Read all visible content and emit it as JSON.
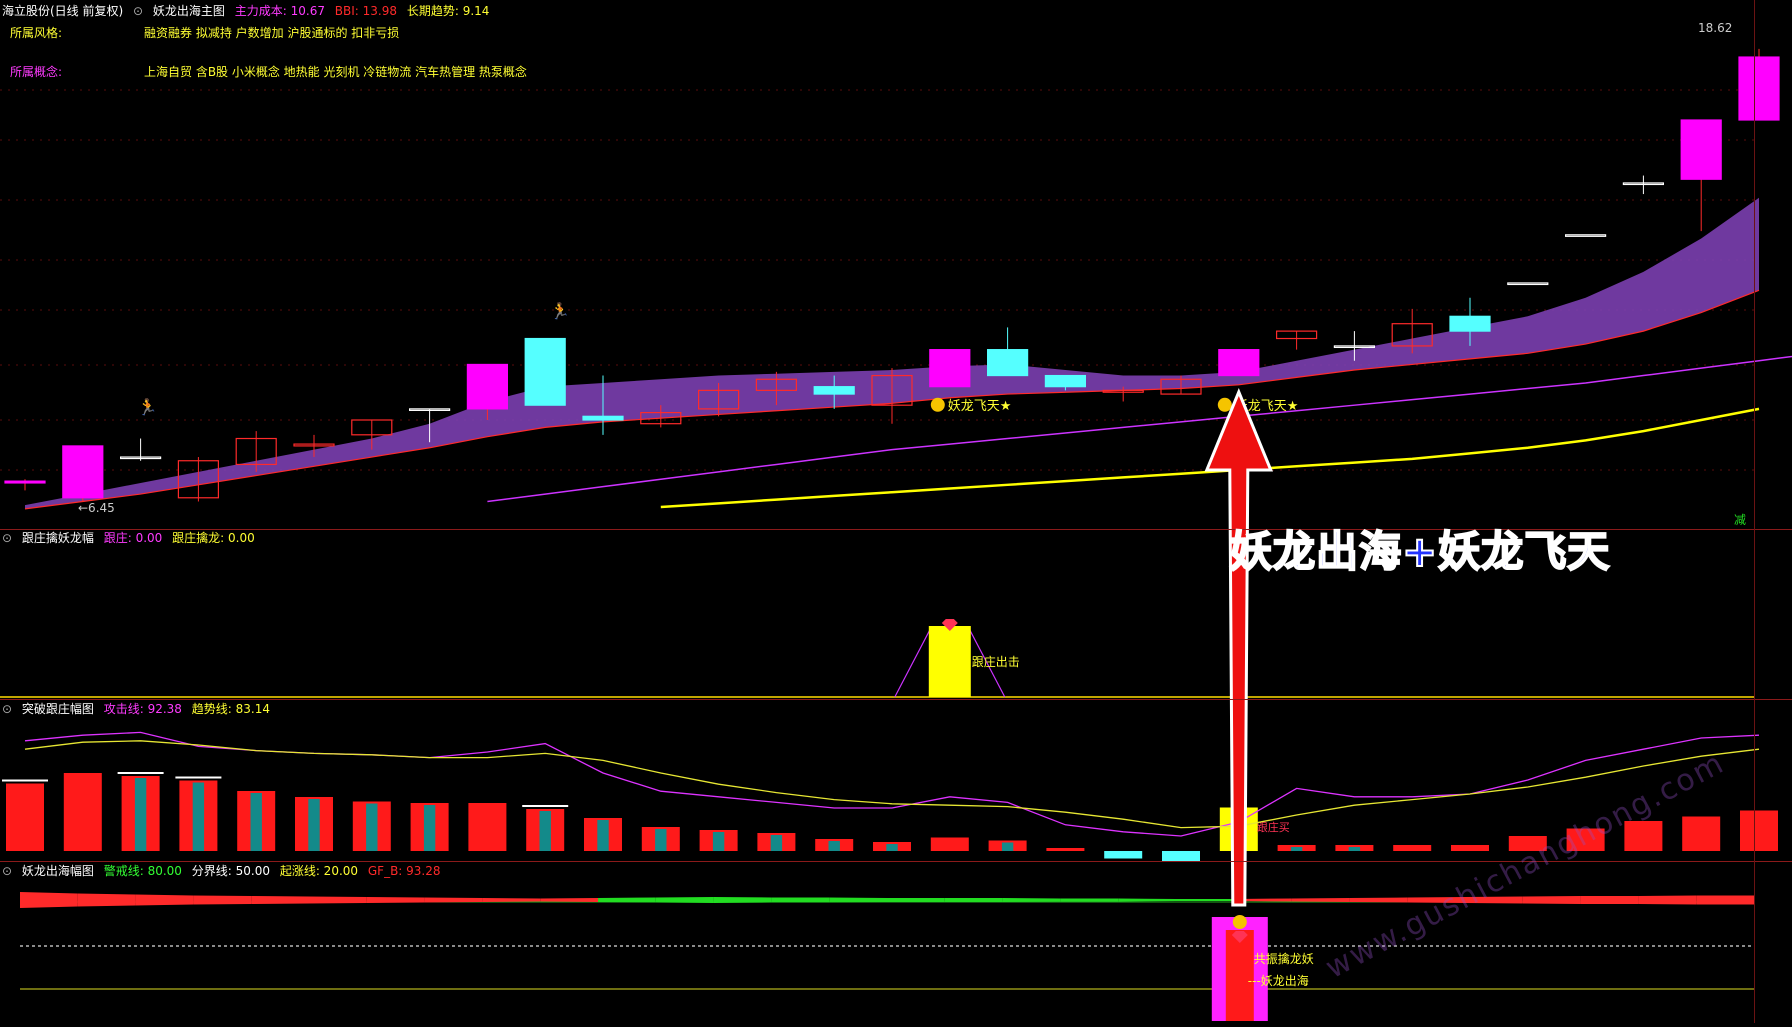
{
  "main_header": {
    "stock": "海立股份(日线 前复权)",
    "indicator": "妖龙出海主图",
    "items": [
      {
        "label": "主力成本: 10.67",
        "color": "#ff3bff"
      },
      {
        "label": "BBI: 13.98",
        "color": "#ff2a2a"
      },
      {
        "label": "长期趋势: 9.14",
        "color": "#ffff33"
      }
    ]
  },
  "info": {
    "style_label": "所属风格:",
    "style_value": "融资融券 拟减持 户数增加 沪股通标的 扣非亏损",
    "concept_label": "所属概念:",
    "concept_value": "上海自贸 含B股 小米概念 地热能 光刻机 冷链物流 汽车热管理 热泵概念"
  },
  "panel2_header": {
    "indicator": "跟庄擒妖龙幅",
    "items": [
      {
        "label": "跟庄: 0.00",
        "color": "#ff3bff"
      },
      {
        "label": "跟庄擒龙: 0.00",
        "color": "#ffff33"
      }
    ]
  },
  "panel3_header": {
    "indicator": "突破跟庄幅图",
    "items": [
      {
        "label": "攻击线: 92.38",
        "color": "#ff3bff"
      },
      {
        "label": "趋势线: 83.14",
        "color": "#ffff33"
      }
    ]
  },
  "panel4_header": {
    "indicator": "妖龙出海幅图",
    "items": [
      {
        "label": "警戒线: 80.00",
        "color": "#33ff33"
      },
      {
        "label": "分界线: 50.00",
        "color": "#ffffff"
      },
      {
        "label": "起涨线: 20.00",
        "color": "#ffff33"
      },
      {
        "label": "GF_B: 93.28",
        "color": "#ff2a2a"
      }
    ]
  },
  "overlay_title": "妖龙出海+妖龙飞天",
  "watermark": "www.gushichanghong.com",
  "colors": {
    "up": "#ff2a2a",
    "down": "#55ffff",
    "magenta": "#ff00ff",
    "yellow": "#ffff00",
    "band": "#7b3fb0",
    "green": "#22dd22"
  },
  "chart_data": [
    {
      "type": "candlestick",
      "name": "main",
      "price_labels": {
        "high": "18.62",
        "low": "6.45"
      },
      "ylim": [
        5.9,
        19.4
      ],
      "annotations": [
        "妖龙飞天★",
        "妖龙飞天★",
        "减"
      ],
      "candles": [
        {
          "o": 6.9,
          "h": 7.0,
          "l": 6.7,
          "c": 6.95,
          "fill": "magenta"
        },
        {
          "o": 6.5,
          "h": 7.9,
          "l": 6.4,
          "c": 7.9,
          "fill": "magenta"
        },
        {
          "o": 7.6,
          "h": 8.1,
          "l": 7.5,
          "c": 7.6,
          "fill": "hollow"
        },
        {
          "o": 6.5,
          "h": 7.6,
          "l": 6.4,
          "c": 7.5,
          "fill": "hollow"
        },
        {
          "o": 7.4,
          "h": 8.3,
          "l": 7.2,
          "c": 8.1,
          "fill": "hollow"
        },
        {
          "o": 7.9,
          "h": 8.2,
          "l": 7.6,
          "c": 7.95,
          "fill": "hollow"
        },
        {
          "o": 8.2,
          "h": 8.6,
          "l": 7.8,
          "c": 8.6,
          "fill": "hollow"
        },
        {
          "o": 8.9,
          "h": 8.9,
          "l": 8.0,
          "c": 8.9,
          "fill": "hollow"
        },
        {
          "o": 8.9,
          "h": 10.1,
          "l": 8.6,
          "c": 10.1,
          "fill": "magenta"
        },
        {
          "o": 10.8,
          "h": 10.8,
          "l": 9.0,
          "c": 9.0,
          "fill": "cyan"
        },
        {
          "o": 8.7,
          "h": 9.8,
          "l": 8.2,
          "c": 8.6,
          "fill": "cyan"
        },
        {
          "o": 8.5,
          "h": 9.0,
          "l": 8.4,
          "c": 8.8,
          "fill": "hollow"
        },
        {
          "o": 8.9,
          "h": 9.6,
          "l": 8.7,
          "c": 9.4,
          "fill": "hollow"
        },
        {
          "o": 9.4,
          "h": 9.9,
          "l": 9.0,
          "c": 9.7,
          "fill": "hollow"
        },
        {
          "o": 9.5,
          "h": 9.8,
          "l": 8.9,
          "c": 9.3,
          "fill": "cyan"
        },
        {
          "o": 9.0,
          "h": 10.0,
          "l": 8.5,
          "c": 9.8,
          "fill": "hollow"
        },
        {
          "o": 9.5,
          "h": 10.5,
          "l": 9.5,
          "c": 10.5,
          "fill": "magenta"
        },
        {
          "o": 10.5,
          "h": 11.1,
          "l": 9.8,
          "c": 9.8,
          "fill": "cyan"
        },
        {
          "o": 9.8,
          "h": 9.8,
          "l": 9.4,
          "c": 9.5,
          "fill": "cyan"
        },
        {
          "o": 9.35,
          "h": 9.5,
          "l": 9.1,
          "c": 9.4,
          "fill": "hollow"
        },
        {
          "o": 9.3,
          "h": 9.8,
          "l": 9.3,
          "c": 9.7,
          "fill": "hollow"
        },
        {
          "o": 9.8,
          "h": 10.5,
          "l": 9.8,
          "c": 10.5,
          "fill": "magenta"
        },
        {
          "o": 10.8,
          "h": 11.0,
          "l": 10.5,
          "c": 11.0,
          "fill": "hollow"
        },
        {
          "o": 10.6,
          "h": 11.0,
          "l": 10.2,
          "c": 10.6,
          "fill": "hollow"
        },
        {
          "o": 10.6,
          "h": 11.6,
          "l": 10.4,
          "c": 11.2,
          "fill": "hollow"
        },
        {
          "o": 11.4,
          "h": 11.9,
          "l": 10.6,
          "c": 11.0,
          "fill": "cyan"
        },
        {
          "o": 12.3,
          "h": 12.3,
          "l": 12.3,
          "c": 12.3,
          "fill": "hollow"
        },
        {
          "o": 13.6,
          "h": 13.6,
          "l": 13.6,
          "c": 13.6,
          "fill": "hollow"
        },
        {
          "o": 15.0,
          "h": 15.2,
          "l": 14.7,
          "c": 15.0,
          "fill": "hollow"
        },
        {
          "o": 15.1,
          "h": 16.7,
          "l": 13.7,
          "c": 16.7,
          "fill": "magenta"
        },
        {
          "o": 16.7,
          "h": 18.62,
          "l": 16.7,
          "c": 18.4,
          "fill": "magenta"
        }
      ],
      "band_upper": [
        6.3,
        6.6,
        6.9,
        7.2,
        7.5,
        7.8,
        8.1,
        8.5,
        9.1,
        9.5,
        9.6,
        9.7,
        9.8,
        9.85,
        9.9,
        9.95,
        10.05,
        10.1,
        9.95,
        9.8,
        9.8,
        9.9,
        10.2,
        10.5,
        10.8,
        11.1,
        11.4,
        11.9,
        12.6,
        13.5,
        14.6
      ],
      "band_lower": [
        6.2,
        6.4,
        6.6,
        6.85,
        7.1,
        7.35,
        7.6,
        7.85,
        8.15,
        8.4,
        8.55,
        8.65,
        8.75,
        8.85,
        8.95,
        9.05,
        9.2,
        9.3,
        9.35,
        9.4,
        9.45,
        9.55,
        9.75,
        9.95,
        10.1,
        10.25,
        10.4,
        10.65,
        11.0,
        11.5,
        12.1
      ],
      "magenta_line_start_index": 8,
      "magenta_line": [
        6.4,
        6.6,
        6.8,
        7.0,
        7.2,
        7.4,
        7.6,
        7.8,
        7.95,
        8.1,
        8.25,
        8.4,
        8.55,
        8.7,
        8.85,
        9.0,
        9.15,
        9.3,
        9.45,
        9.6,
        9.8,
        10.0,
        10.2,
        10.4
      ],
      "yellow_line_start_index": 11,
      "yellow_line": [
        6.25,
        6.35,
        6.45,
        6.55,
        6.65,
        6.75,
        6.85,
        6.95,
        7.05,
        7.15,
        7.25,
        7.35,
        7.45,
        7.55,
        7.7,
        7.85,
        8.05,
        8.3,
        8.6,
        8.9
      ]
    },
    {
      "type": "bar",
      "name": "跟庄擒妖龙幅",
      "label": "跟庄出击",
      "bar_index": 16,
      "value": 1
    },
    {
      "type": "bar",
      "name": "突破跟庄幅图",
      "ylim": [
        0,
        100
      ],
      "label": "跟庄买",
      "bars": [
        {
          "v": 45,
          "s": "red",
          "cap": true
        },
        {
          "v": 52,
          "s": "red",
          "cap": false
        },
        {
          "v": 50,
          "s": "split",
          "cap": true
        },
        {
          "v": 47,
          "s": "split",
          "cap": true
        },
        {
          "v": 40,
          "s": "split",
          "cap": false
        },
        {
          "v": 36,
          "s": "split",
          "cap": false
        },
        {
          "v": 33,
          "s": "split",
          "cap": false
        },
        {
          "v": 32,
          "s": "split",
          "cap": false
        },
        {
          "v": 32,
          "s": "red",
          "cap": false
        },
        {
          "v": 28,
          "s": "split",
          "cap": true
        },
        {
          "v": 22,
          "s": "split",
          "cap": false
        },
        {
          "v": 16,
          "s": "split",
          "cap": false
        },
        {
          "v": 14,
          "s": "split",
          "cap": false
        },
        {
          "v": 12,
          "s": "split",
          "cap": false
        },
        {
          "v": 8,
          "s": "split",
          "cap": false
        },
        {
          "v": 6,
          "s": "split",
          "cap": false
        },
        {
          "v": 9,
          "s": "red",
          "cap": false
        },
        {
          "v": 7,
          "s": "split",
          "cap": false
        },
        {
          "v": 2,
          "s": "red",
          "cap": false
        },
        {
          "v": -5,
          "s": "cyan",
          "cap": false
        },
        {
          "v": -7,
          "s": "cyan",
          "cap": false
        },
        {
          "v": 29,
          "s": "yellow",
          "cap": false
        },
        {
          "v": 4,
          "s": "split",
          "cap": false
        },
        {
          "v": 4,
          "s": "split",
          "cap": false
        },
        {
          "v": 4,
          "s": "red",
          "cap": false
        },
        {
          "v": 4,
          "s": "red",
          "cap": false
        },
        {
          "v": 10,
          "s": "red",
          "cap": false
        },
        {
          "v": 15,
          "s": "red",
          "cap": false
        },
        {
          "v": 20,
          "s": "red",
          "cap": false
        },
        {
          "v": 23,
          "s": "red",
          "cap": false
        },
        {
          "v": 27,
          "s": "red",
          "cap": false
        }
      ],
      "attack_line": [
        78,
        82,
        84,
        74,
        71,
        69,
        68,
        66,
        70,
        76,
        55,
        42,
        38,
        34,
        30,
        30,
        38,
        34,
        18,
        13,
        10,
        20,
        44,
        38,
        38,
        40,
        50,
        64,
        72,
        80,
        82
      ],
      "trend_line": [
        72,
        77,
        78,
        75,
        71,
        69,
        68,
        66,
        66,
        69,
        64,
        55,
        47,
        41,
        36,
        33,
        32,
        31,
        27,
        22,
        16,
        17,
        25,
        32,
        36,
        40,
        45,
        52,
        60,
        67,
        72
      ]
    },
    {
      "type": "area",
      "name": "妖龙出海幅图",
      "ylim": [
        0,
        100
      ],
      "lines": [
        80,
        50,
        20
      ],
      "labels": [
        "共振擒龙妖",
        "---妖龙出海"
      ],
      "signal_index": 21,
      "ribbon_sign": [
        1,
        1,
        1,
        1,
        1,
        1,
        1,
        1,
        1,
        1,
        -1,
        -1,
        -1,
        -1,
        -1,
        -1,
        -1,
        -1,
        -1,
        -1,
        -1,
        1,
        1,
        1,
        1,
        1,
        1,
        1,
        1,
        1,
        1
      ],
      "ribbon_thick": [
        16,
        13,
        11,
        9,
        8,
        7,
        6,
        5,
        4,
        3,
        4,
        5,
        6,
        5,
        5,
        4,
        4,
        4,
        3,
        3,
        2,
        2,
        3,
        4,
        5,
        6,
        7,
        8,
        8,
        9,
        9
      ]
    }
  ]
}
